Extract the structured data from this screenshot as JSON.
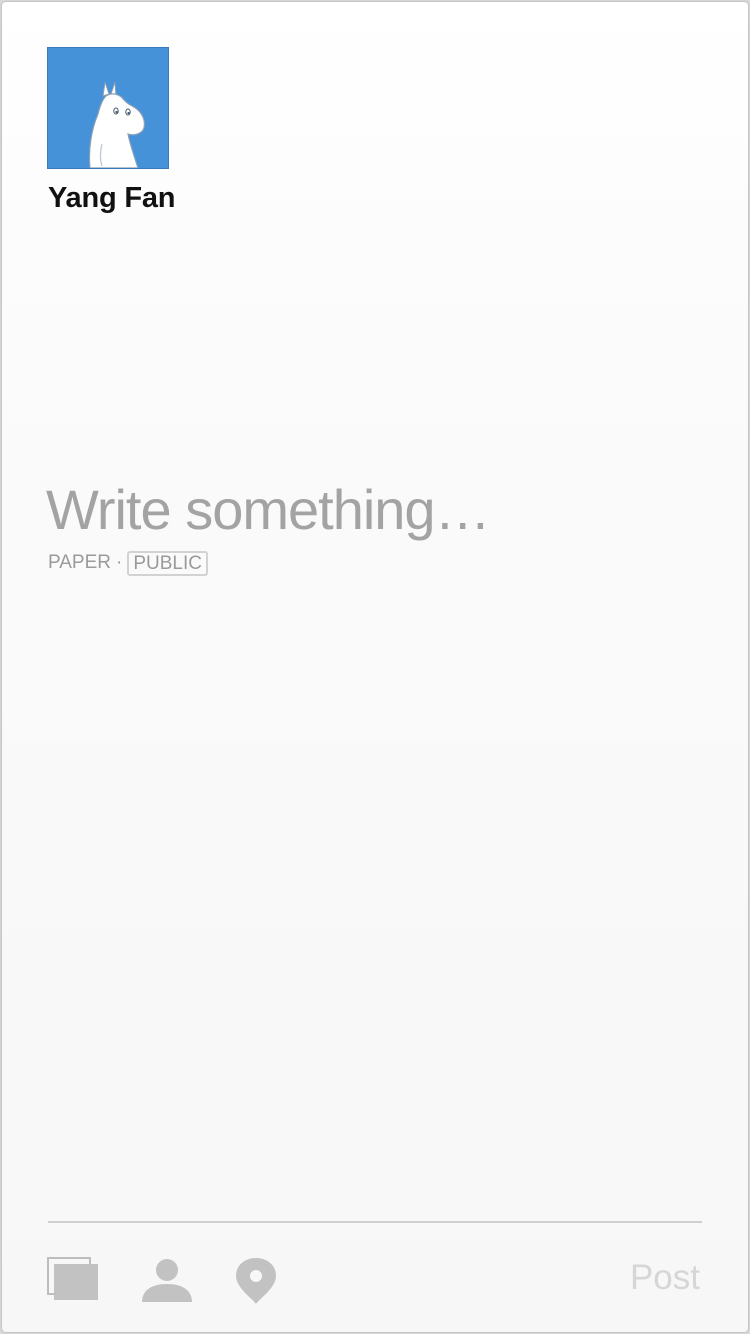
{
  "author": {
    "name": "Yang Fan",
    "avatar_icon": "moomin-avatar-icon",
    "avatar_bg": "#4592d8"
  },
  "composer": {
    "placeholder": "Write something…",
    "section_label": "PAPER",
    "separator": "·",
    "privacy": "PUBLIC"
  },
  "toolbar": {
    "tools": [
      {
        "name": "photos-icon"
      },
      {
        "name": "tag-person-icon"
      },
      {
        "name": "location-icon"
      }
    ],
    "post_label": "Post",
    "post_color": "#d6d6d6"
  }
}
